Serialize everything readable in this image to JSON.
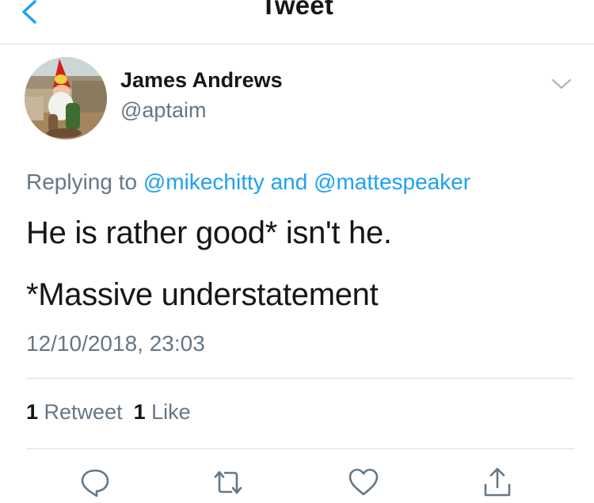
{
  "nav": {
    "title": "Tweet",
    "back_icon": "chevron-left-icon"
  },
  "author": {
    "display_name": "James Andrews",
    "handle": "@aptaim",
    "avatar": "gnome-avatar"
  },
  "reply_context": {
    "prefix": "Replying to",
    "mention1": "@mikechitty",
    "conjunction": "and",
    "mention2": "@mattespeaker"
  },
  "tweet": {
    "line1": "He is rather good* isn't he.",
    "line2": "*Massive understatement",
    "timestamp": "12/10/2018, 23:03"
  },
  "stats": {
    "retweet_count": "1",
    "retweet_label": "Retweet",
    "like_count": "1",
    "like_label": "Like"
  },
  "actions": [
    {
      "icon": "reply-icon"
    },
    {
      "icon": "retweet-icon"
    },
    {
      "icon": "heart-icon"
    },
    {
      "icon": "share-icon"
    }
  ],
  "colors": {
    "accent": "#1da1f2",
    "text_primary": "#14171a",
    "text_secondary": "#657786",
    "divider": "#d8dde2"
  }
}
